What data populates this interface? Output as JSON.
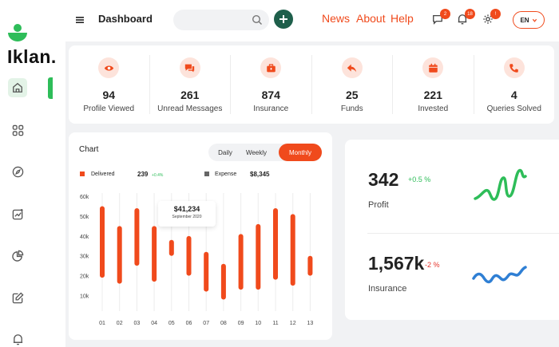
{
  "brand": {
    "name": "Iklan.",
    "color": "#2ebd59"
  },
  "header": {
    "title": "Dashboard",
    "search": {
      "value": "",
      "placeholder": ""
    },
    "nav": [
      "News",
      "About",
      "Help"
    ],
    "badges": {
      "messages": "2",
      "notifications": "18",
      "alerts": "!"
    },
    "language": "EN"
  },
  "stats": [
    {
      "icon": "eye-icon",
      "value": "94",
      "label": "Profile Viewed"
    },
    {
      "icon": "chat-icon",
      "value": "261",
      "label": "Unread Messages"
    },
    {
      "icon": "briefcase-icon",
      "value": "874",
      "label": "Insurance"
    },
    {
      "icon": "reply-icon",
      "value": "25",
      "label": "Funds"
    },
    {
      "icon": "calendar-icon",
      "value": "221",
      "label": "Invested"
    },
    {
      "icon": "phone-icon",
      "value": "4",
      "label": "Queries Solved"
    }
  ],
  "chart_card": {
    "title": "Chart",
    "tabs": [
      "Daily",
      "Weekly",
      "Monthly"
    ],
    "active_tab": "Monthly",
    "legend": {
      "delivered": {
        "label": "Delivered",
        "value": "239",
        "delta": "+0.4%"
      },
      "expense": {
        "label": "Expense",
        "value": "$8,345"
      }
    },
    "tooltip": {
      "value": "$41,234",
      "date": "September 2020"
    }
  },
  "chart_data": {
    "type": "bar",
    "categories": [
      "01",
      "02",
      "03",
      "04",
      "05",
      "06",
      "07",
      "08",
      "09",
      "10",
      "11",
      "12",
      "13"
    ],
    "y_ticks": [
      "60k",
      "50k",
      "40k",
      "30k",
      "20k",
      "10k"
    ],
    "ylim": [
      5,
      60
    ],
    "series": [
      {
        "color": "#f04a1c",
        "ranges": [
          [
            19,
            55
          ],
          [
            16,
            45
          ],
          [
            25,
            54
          ],
          [
            17,
            45
          ],
          [
            30,
            38
          ],
          [
            20,
            40
          ],
          [
            12,
            32
          ],
          [
            8,
            26
          ],
          [
            13,
            41
          ],
          [
            13,
            46
          ],
          [
            18,
            54
          ],
          [
            15,
            51
          ],
          [
            20,
            30
          ]
        ]
      }
    ],
    "grid": "vertical",
    "legend_position": "top-left"
  },
  "metrics": [
    {
      "value": "342",
      "delta": "+0.5 %",
      "delta_color": "#2ebd59",
      "label": "Profit",
      "spark_color": "#2ebd59",
      "spark_icon": "green-sparkline"
    },
    {
      "value": "1,567k",
      "delta": "-2 %",
      "delta_color": "#e5332a",
      "label": "Insurance",
      "spark_color": "#2f7fd4",
      "spark_icon": "blue-sparkline"
    }
  ],
  "colors": {
    "accent": "#f04a1c",
    "dark_green": "#1e5f4b",
    "grey": "#666666"
  }
}
